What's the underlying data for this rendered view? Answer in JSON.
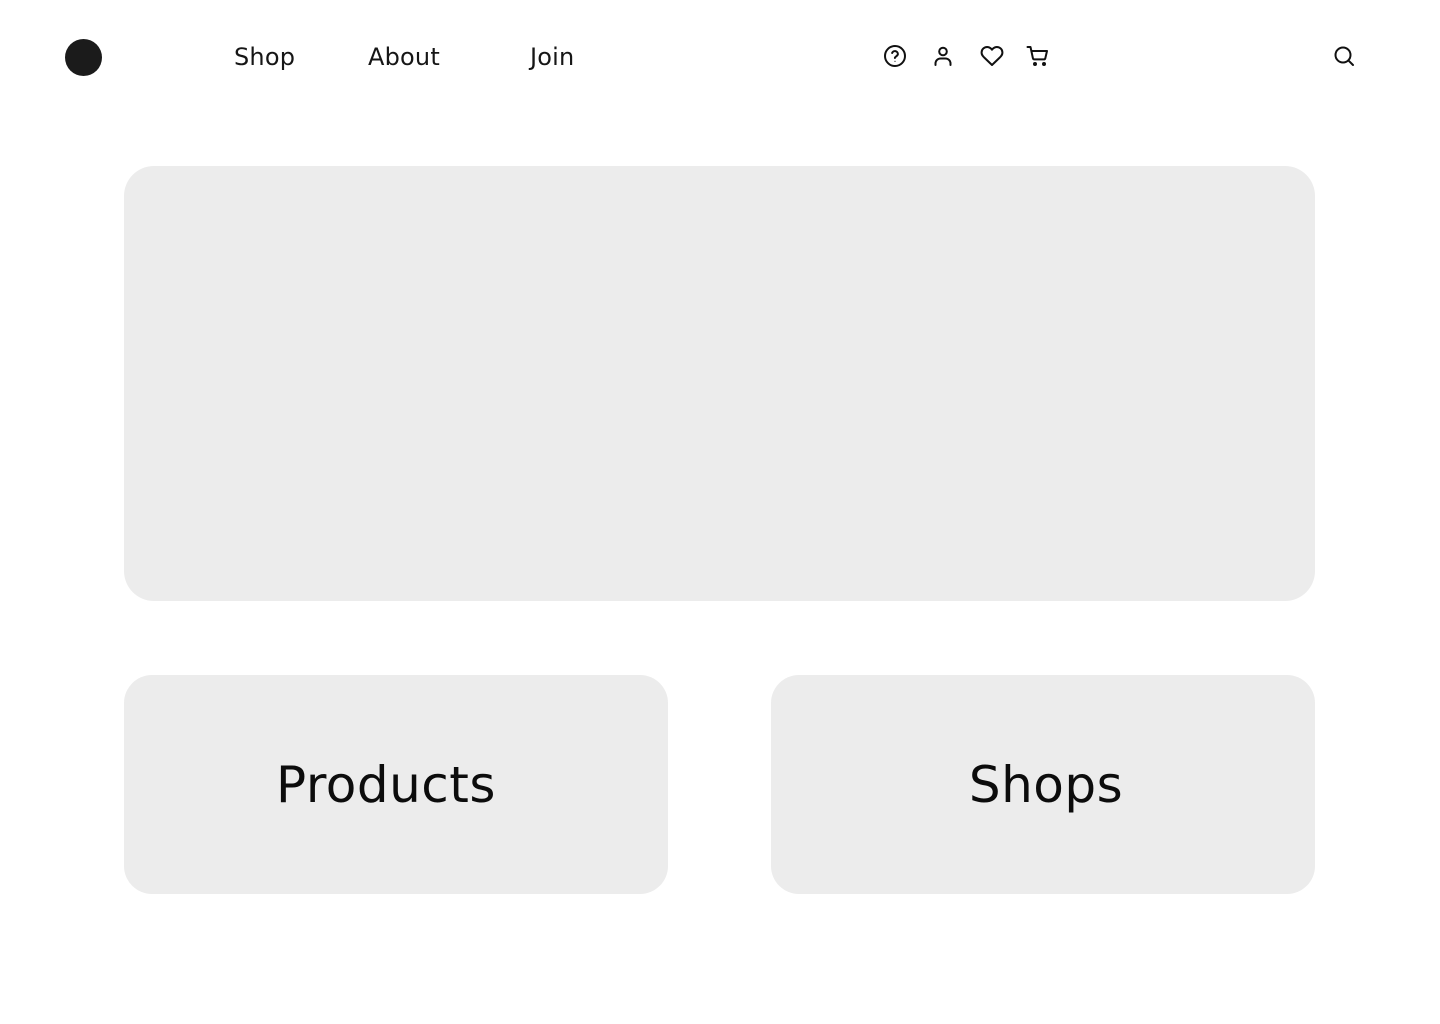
{
  "header": {
    "logo_icon": "brand-logo-circle",
    "nav": [
      {
        "label": "Shop"
      },
      {
        "label": "About"
      },
      {
        "label": "Join"
      }
    ],
    "icons": [
      "help-icon",
      "user-icon",
      "heart-icon",
      "cart-icon"
    ],
    "search_icon": "search-icon"
  },
  "main": {
    "hero": {},
    "cards": [
      {
        "label": "Products"
      },
      {
        "label": "Shops"
      }
    ]
  },
  "colors": {
    "background": "#ffffff",
    "panel": "#ececec",
    "text": "#111111",
    "logo": "#1b1b1b"
  }
}
